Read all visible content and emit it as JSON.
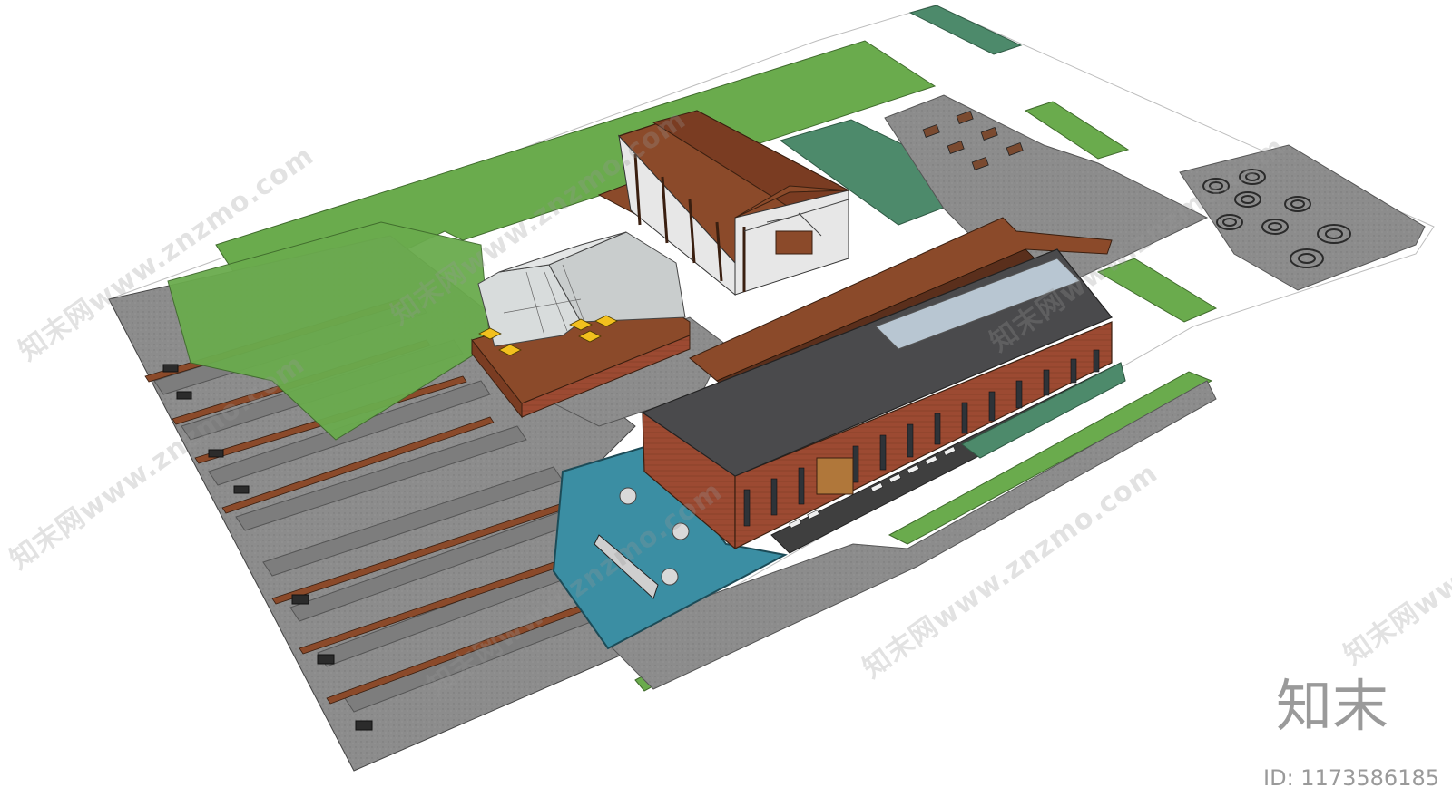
{
  "watermark": {
    "text": "知末网www.znzmo.com",
    "logo": "知末",
    "asset_id": "ID: 1173586185"
  },
  "scene": {
    "colors": {
      "background": "#ffffff",
      "grass": "#6aab4d",
      "dark_green": "#4d8a6b",
      "paving": "#8a8a8a",
      "paving_dark": "#6c6c6c",
      "timber": "#8b4a2a",
      "brick": "#9c4a32",
      "roof": "#4a4a4c",
      "water": "#3b8ea3",
      "glass": "#d8dcdc"
    }
  }
}
